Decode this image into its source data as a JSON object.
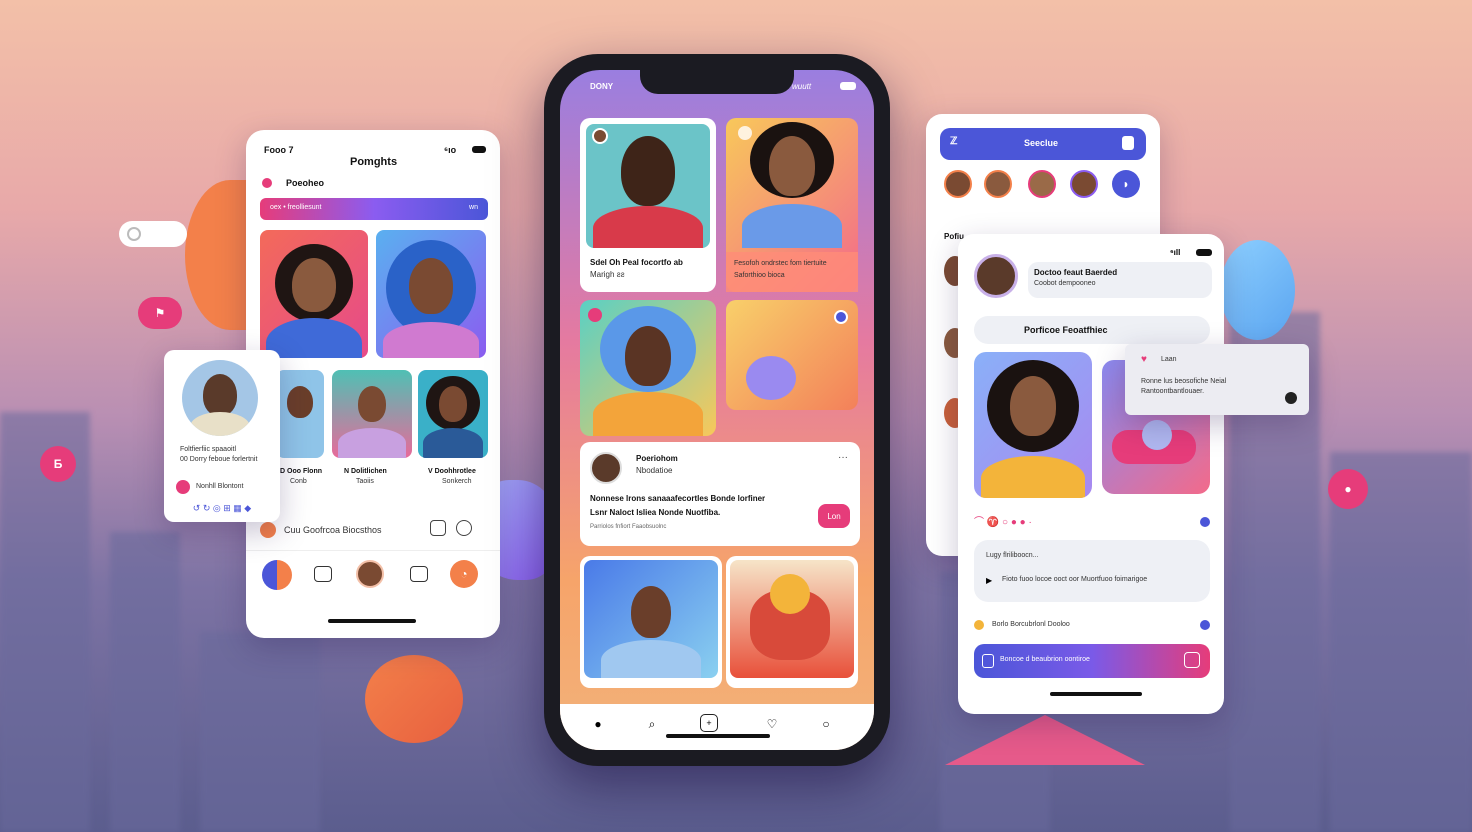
{
  "left_card": {
    "status_time": "Fooo 7",
    "status_right": "⁶ıo",
    "title": "Pomghts",
    "section_label": "Poeoheo",
    "banner_left": "oex • freolliesunt",
    "banner_right": "wn",
    "tags": [
      {
        "label": "D Ooo Flonn",
        "sub": "Conb"
      },
      {
        "label": "N Dolitlichen",
        "sub": "Taoiis"
      },
      {
        "label": "V Doohhrotlee",
        "sub": "Sonkerch"
      }
    ],
    "footer_text": "Cuu Goofrcoa Biocsthos"
  },
  "profile_popup": {
    "line1": "Foltfierfiic spaaoitl",
    "line2": "00 Dorry feboue forlertnit",
    "action": "Nonhll Blontont"
  },
  "phone": {
    "status_left": "DONY",
    "status_right": "wuutt",
    "post1_caption": "Sdel Oh Peal focortfo ab",
    "post1_sub": "Marigh  ƨƨ",
    "post2_caption": "Fesofoh ondrstec fom tiertuite",
    "post2_sub": "Saforthioo bioca",
    "feed_name": "Poeriohom",
    "feed_handle": "Nbodatioe",
    "feed_text_line1": "Nonnese lrons sanaaafecortles Bonde lorfiner",
    "feed_text_line2": "Lsnr Naloct lsliea   Nonde Nuotfiba.",
    "feed_tags": "Parriolos fnfiort Faaobsuolnc",
    "feed_button": "Lon"
  },
  "right_back_card": {
    "header_title": "Seeclue",
    "section": "Pofiu"
  },
  "right_card": {
    "user_name": "Doctoo feaut Baerded",
    "user_sub": "Coobot dempooneo",
    "section_title": "Porficoe Feoatfhiec",
    "popup_label": "Laan",
    "popup_text_line1": "Ronne lus beosofiche Neial",
    "popup_text_line2": "Rantoontbantlouaer.",
    "comment_label": "Lugy flriliboocn...",
    "comment_text": "Fioto fuoo locoe ooct oor Muortfuoo foimarigoe",
    "row_text": "Borlo Borcubrlonl Dooloo",
    "cta_text": "Boncoe d beaubrion oontiroe"
  },
  "colors": {
    "accent_blue": "#4b56d8",
    "accent_pink": "#e63c7a",
    "accent_orange": "#f3804a"
  }
}
